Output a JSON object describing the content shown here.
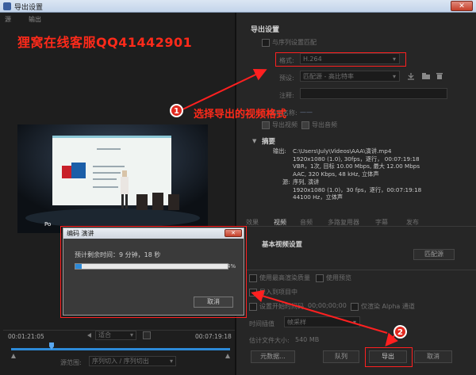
{
  "window": {
    "title": "导出设置",
    "close_glyph": "✕"
  },
  "left_tabs": [
    "源",
    "输出"
  ],
  "watermark": "狸窝在线客服QQ41442901",
  "export_settings": {
    "header": "导出设置",
    "match_sequence": "与序列设置匹配",
    "format_label": "格式:",
    "format_value": "H.264",
    "preset_label": "预设:",
    "preset_value": "匹配源 - 高比特率",
    "comment_label": "注释:",
    "output_name_label": "输出名称:",
    "output_name_value": "——",
    "export_video": "导出视频",
    "export_audio": "导出音频"
  },
  "summary": {
    "header": "摘要",
    "output_label": "输出:",
    "output_lines": [
      "C:\\Users\\July\\Videos\\AAA\\演讲.mp4",
      "1920x1080 (1.0), 30fps，逐行， 00:07:19:18",
      "VBR，1次, 目标 10.00 Mbps, 最大 12.00 Mbps",
      "AAC, 320 Kbps, 48 kHz, 立体声"
    ],
    "source_label": "源:",
    "source_lines": [
      "序列, 演讲",
      "1920x1080 (1.0)，30 fps，逐行，00:07:19:18",
      "44100 Hz，立体声"
    ]
  },
  "settings_tabs": [
    "效果",
    "视频",
    "音频",
    "多路复用器",
    "字幕",
    "发布"
  ],
  "basic_video": {
    "header": "基本视频设置",
    "match_source": "匹配源"
  },
  "options": {
    "max_render": "使用最高渲染质量",
    "use_preview": "使用预览",
    "import_project": "导入到项目中",
    "set_start_tc": "设置开始时间码",
    "start_tc_value": "00;00;00;00",
    "render_alpha": "仅渲染 Alpha 通道",
    "interp_label": "时间插值",
    "interp_value": "帧采样",
    "file_size_label": "估计文件大小:",
    "file_size_value": "540 MB"
  },
  "bottom_buttons": {
    "metadata": "元数据...",
    "queue": "队列",
    "export": "导出",
    "cancel": "取消"
  },
  "timeline": {
    "current_tc": "00:01:21:05",
    "end_tc": "00:07:19:18",
    "zoom_value": "适合",
    "range_label": "源范围:",
    "range_value": "序列切入 / 序列切出"
  },
  "annotations": {
    "step1_number": "1",
    "step1_text": "选择导出的视频格式",
    "step2_number": "2"
  },
  "dialog": {
    "title": "编码 演讲",
    "remaining_text": "预计剩余时间：9 分钟，18 秒",
    "percent": "4%",
    "progress": 4,
    "cancel": "取消"
  },
  "video_frame": {
    "logo_text": "Po"
  },
  "colors": {
    "accent_blue": "#2d8ad8",
    "annotation_red": "#ff2020",
    "watermark_red": "#ff2a1a"
  }
}
